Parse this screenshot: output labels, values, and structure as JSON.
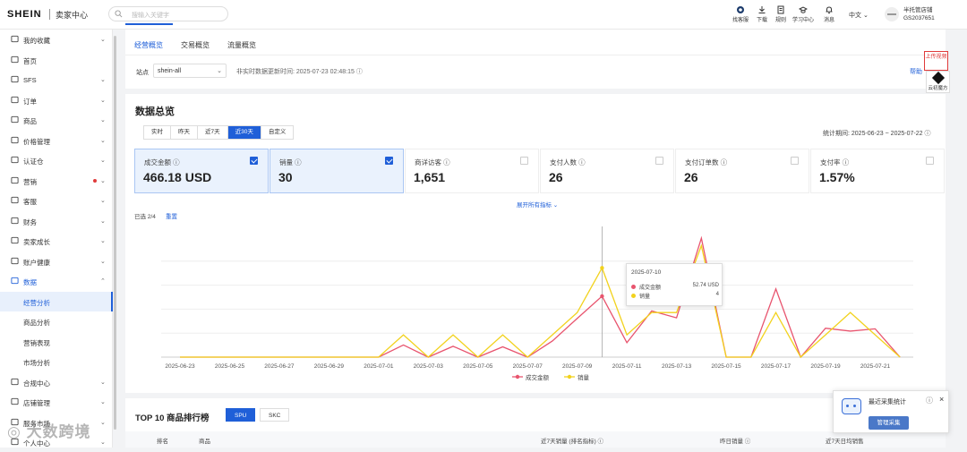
{
  "header": {
    "logo": "SHEIN",
    "logo_sub": "卖家中心",
    "search_placeholder": "搜输入关键字",
    "tools": [
      {
        "label": "找客服",
        "icon": "customer-service-icon"
      },
      {
        "label": "下载",
        "icon": "download-icon"
      },
      {
        "label": "规则",
        "icon": "rules-icon"
      },
      {
        "label": "学习中心",
        "icon": "learning-center-icon"
      },
      {
        "label": "消息",
        "icon": "bell-icon"
      }
    ],
    "language": "中文",
    "store_name": "半托管店铺",
    "store_id": "GS2037651"
  },
  "sidebar": {
    "items": [
      {
        "label": "我的收藏",
        "icon": "star-icon",
        "chevron": "⌄"
      },
      {
        "label": "首页",
        "icon": "list-icon"
      },
      {
        "label": "SFS",
        "icon": "list-icon",
        "chevron": "⌄"
      },
      {
        "label": "订单",
        "icon": "list-icon",
        "chevron": "⌄"
      },
      {
        "label": "商品",
        "icon": "bag-icon",
        "chevron": "⌄"
      },
      {
        "label": "价格管理",
        "icon": "price-icon",
        "chevron": "⌄"
      },
      {
        "label": "认证仓",
        "icon": "list-icon",
        "chevron": "⌄"
      },
      {
        "label": "营销",
        "icon": "tag-icon",
        "chevron": "⌄",
        "dot": true
      },
      {
        "label": "客服",
        "icon": "chat-icon",
        "chevron": "⌄"
      },
      {
        "label": "财务",
        "icon": "finance-icon",
        "chevron": "⌄"
      },
      {
        "label": "卖家成长",
        "icon": "growth-icon",
        "chevron": "⌄"
      },
      {
        "label": "账户健康",
        "icon": "health-icon",
        "chevron": "⌄"
      },
      {
        "label": "数据",
        "icon": "data-icon",
        "chevron": "⌃",
        "expanded": true
      },
      {
        "label": "经营分析",
        "sub": true,
        "active": true
      },
      {
        "label": "商品分析",
        "sub": true
      },
      {
        "label": "营销表现",
        "sub": true
      },
      {
        "label": "市场分析",
        "sub": true
      },
      {
        "label": "合规中心",
        "icon": "compliance-icon",
        "chevron": "⌄"
      },
      {
        "label": "店铺管理",
        "icon": "store-icon",
        "chevron": "⌄"
      },
      {
        "label": "服务市场",
        "icon": "market-icon",
        "chevron": "⌄"
      },
      {
        "label": "个人中心",
        "icon": "user-icon",
        "chevron": "⌄"
      }
    ]
  },
  "tabs": [
    "经营概览",
    "交易概览",
    "流量概览"
  ],
  "filter": {
    "site_label": "站点",
    "site_value": "shein-all",
    "update_time": "非实时数据更新时间: 2025-07-23 02:48:15",
    "help": "帮助"
  },
  "floating": {
    "upload": "上传视频",
    "ai": "云初魔方"
  },
  "overview": {
    "title": "数据总览",
    "ranges": [
      "实时",
      "昨天",
      "近7天",
      "近30天",
      "自定义"
    ],
    "active_range": 3,
    "stat_period": "统计期间: 2025-06-23 ~ 2025-07-22",
    "metrics": [
      {
        "label": "成交金额",
        "value": "466.18 USD",
        "selected": true
      },
      {
        "label": "销量",
        "value": "30",
        "selected": true
      },
      {
        "label": "商详访客",
        "value": "1,651",
        "selected": false
      },
      {
        "label": "支付人数",
        "value": "26",
        "selected": false
      },
      {
        "label": "支付订单数",
        "value": "26",
        "selected": false
      },
      {
        "label": "支付率",
        "value": "1.57%",
        "selected": false
      }
    ],
    "expand_all": "展开所有指标",
    "selected_count": "已选 2/4",
    "reset": "重置"
  },
  "chart_data": {
    "type": "line",
    "x": [
      "2025-06-23",
      "2025-06-24",
      "2025-06-25",
      "2025-06-26",
      "2025-06-27",
      "2025-06-28",
      "2025-06-29",
      "2025-06-30",
      "2025-07-01",
      "2025-07-02",
      "2025-07-03",
      "2025-07-04",
      "2025-07-05",
      "2025-07-06",
      "2025-07-07",
      "2025-07-08",
      "2025-07-09",
      "2025-07-10",
      "2025-07-11",
      "2025-07-12",
      "2025-07-13",
      "2025-07-14",
      "2025-07-15",
      "2025-07-16",
      "2025-07-17",
      "2025-07-18",
      "2025-07-19",
      "2025-07-20",
      "2025-07-21",
      "2025-07-22"
    ],
    "tick_labels": [
      "2025-06-23",
      "2025-06-25",
      "2025-06-27",
      "2025-06-29",
      "2025-07-01",
      "2025-07-03",
      "2025-07-05",
      "2025-07-07",
      "2025-07-09",
      "2025-07-11",
      "2025-07-13",
      "2025-07-15",
      "2025-07-17",
      "2025-07-19",
      "2025-07-21"
    ],
    "series": [
      {
        "name": "成交金额",
        "color": "#e8546e",
        "values": [
          0,
          0,
          0,
          0,
          0,
          0,
          0,
          0,
          0,
          10.5,
          0,
          9.4,
          0,
          8.9,
          0,
          14.0,
          33.5,
          52.74,
          12.5,
          40,
          34,
          103,
          0,
          0,
          59,
          0,
          25,
          22.5,
          24.5,
          0
        ]
      },
      {
        "name": "销量",
        "color": "#f2d21d",
        "values": [
          0,
          0,
          0,
          0,
          0,
          0,
          0,
          0,
          0,
          1,
          0,
          1,
          0,
          1,
          0,
          1,
          2,
          4,
          1,
          2,
          2,
          5,
          0,
          0,
          2,
          0,
          1,
          2,
          1,
          0
        ]
      }
    ],
    "hover_index": 17
  },
  "tooltip": {
    "date": "2025-07-10",
    "rows": [
      {
        "name": "成交金额",
        "value": "52.74 USD",
        "color": "#e8546e"
      },
      {
        "name": "销量",
        "value": "4",
        "color": "#f2d21d"
      }
    ]
  },
  "top10": {
    "title": "TOP 10 商品排行榜",
    "segments": [
      "SPU",
      "SKC"
    ],
    "columns": [
      "排名",
      "商品",
      "近7天销量 (排名指标)",
      "昨日销量",
      "近7天日均销售"
    ]
  },
  "collect_popup": {
    "title": "最近采集统计",
    "button": "管理采集"
  },
  "watermark": "大数跨境"
}
